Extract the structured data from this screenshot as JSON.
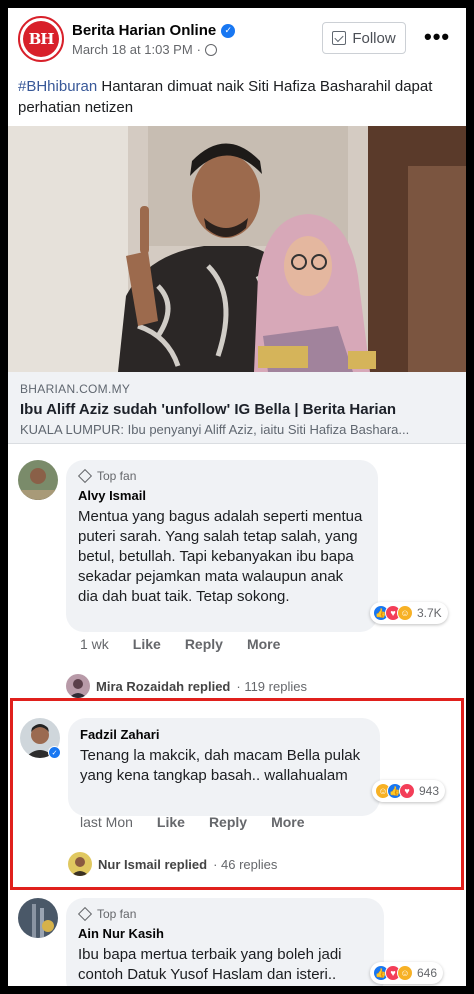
{
  "post": {
    "page_name": "Berita Harian Online",
    "avatar_text": "BH",
    "date": "March 18 at 1:03 PM",
    "separator": "·",
    "follow_label": "Follow",
    "more": "•••",
    "hashtag": "#BHhiburan",
    "text": " Hantaran dimuat naik Siti Hafiza Basharahil dapat perhatian netizen"
  },
  "link": {
    "domain": "BHARIAN.COM.MY",
    "title": "Ibu Aliff Aziz sudah 'unfollow' IG Bella | Berita Harian",
    "description": "KUALA LUMPUR: Ibu penyanyi Aliff Aziz, iaitu Siti Hafiza Bashara..."
  },
  "comments": [
    {
      "badge": "Top fan",
      "name": "Alvy Ismail",
      "text": "Mentua yang bagus adalah seperti mentua puteri sarah. Yang salah tetap salah, yang betul, betullah. Tapi kebanyakan ibu bapa sekadar pejamkan mata walaupun anak dia dah buat taik. Tetap sokong.",
      "reactions": "3.7K",
      "time": "1 wk",
      "like": "Like",
      "reply": "Reply",
      "more": "More",
      "replied_by": "Mira Rozaidah replied",
      "replies": "· 119 replies"
    },
    {
      "name": "Fadzil Zahari",
      "text": "Tenang la makcik, dah macam Bella pulak yang kena tangkap basah.. wallahualam",
      "reactions": "943",
      "time": "last Mon",
      "like": "Like",
      "reply": "Reply",
      "more": "More",
      "replied_by": "Nur Ismail replied",
      "replies": "· 46 replies"
    },
    {
      "badge": "Top fan",
      "name": "Ain Nur Kasih",
      "text": "Ibu bapa mertua terbaik yang boleh jadi contoh Datuk Yusof Haslam dan isteri..",
      "reactions": "646"
    }
  ],
  "colors": {
    "accent_blue": "#1877f2",
    "highlight_red": "#e0201c",
    "bubble_bg": "#f0f2f5",
    "brand_red": "#d8202a"
  }
}
